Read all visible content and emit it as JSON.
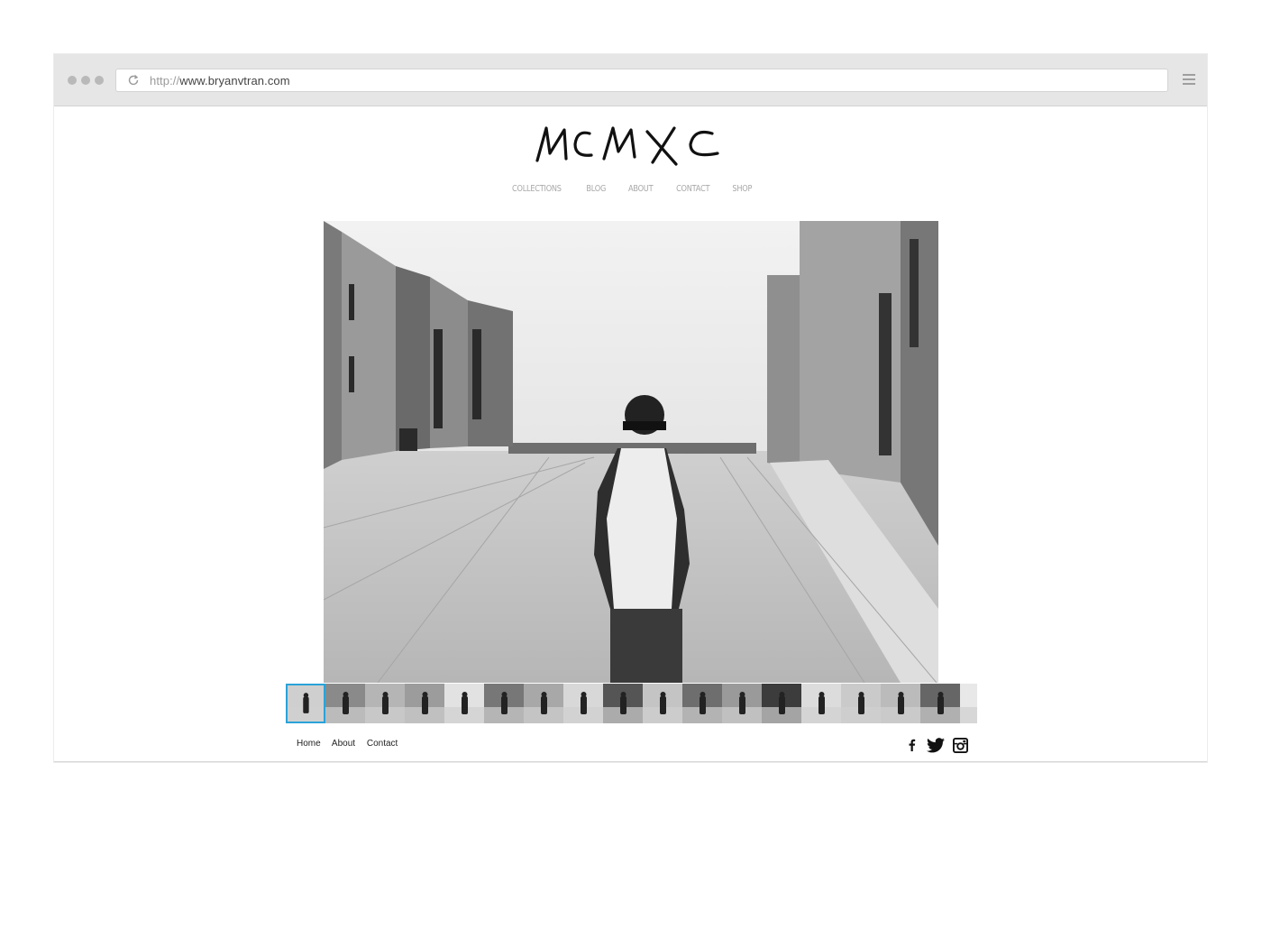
{
  "browser": {
    "url_protocol": "http://",
    "url_host": "www.bryanvtran.com",
    "reload_icon": "reload-icon",
    "menu_icon": "hamburger-menu-icon"
  },
  "site": {
    "logo_text": "MCMXC",
    "nav": [
      "COLLECTIONS",
      "BLOG",
      "ABOUT",
      "CONTACT",
      "SHOP"
    ],
    "thumbnail_count": 18,
    "active_thumbnail": 0,
    "footer_links": [
      "Home",
      "About",
      "Contact"
    ],
    "social_icons": [
      "facebook-icon",
      "twitter-icon",
      "instagram-icon"
    ],
    "accent_color": "#2aa3d8"
  }
}
